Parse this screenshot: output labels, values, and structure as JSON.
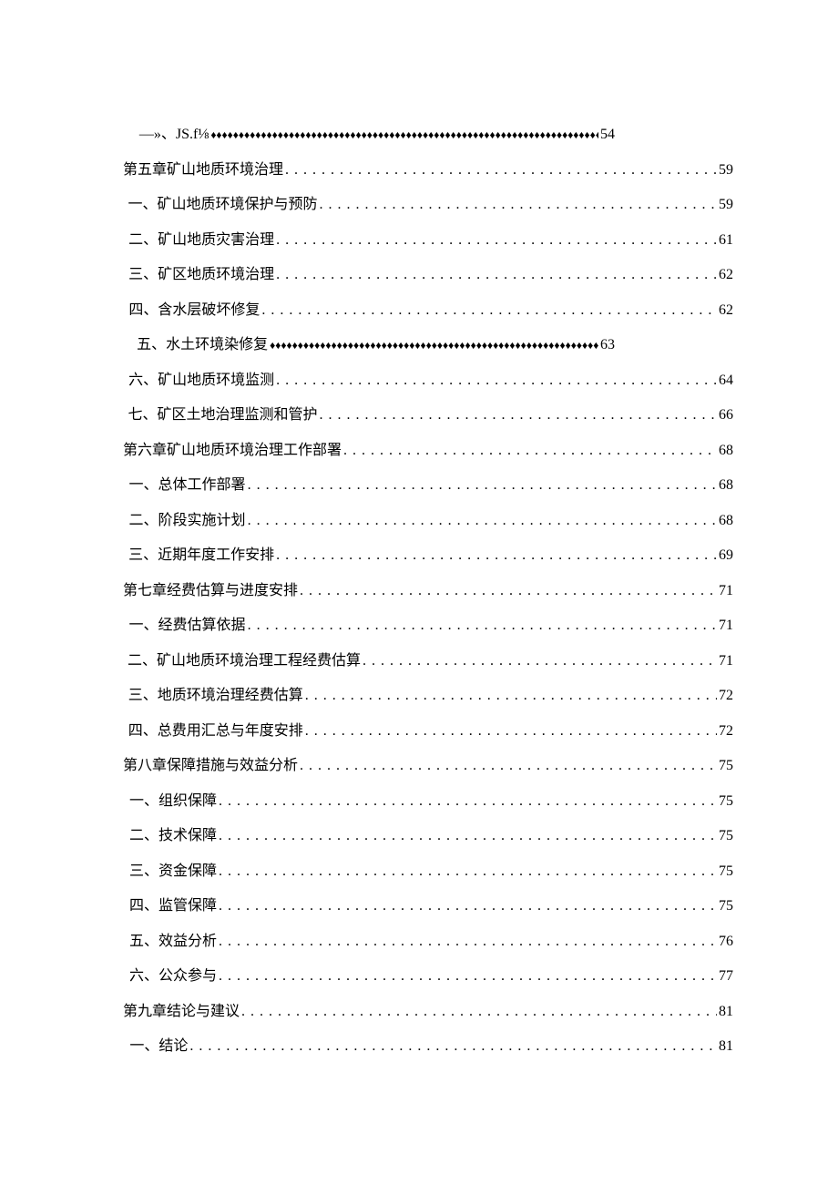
{
  "toc": [
    {
      "level": 2,
      "label": "—»、JS.f⅛",
      "page": "54",
      "leader": "diamonds",
      "short": true
    },
    {
      "level": 1,
      "label": "第五章矿山地质环境治理",
      "page": "59",
      "leader": "dots"
    },
    {
      "level": 2,
      "label": "一、矿山地质环境保护与预防",
      "page": "59",
      "leader": "dots"
    },
    {
      "level": 2,
      "label": "二、矿山地质灾害治理",
      "page": "61",
      "leader": "dots"
    },
    {
      "level": 2,
      "label": "三、矿区地质环境治理",
      "page": "62",
      "leader": "dots"
    },
    {
      "level": 2,
      "label": "四、含水层破坏修复",
      "page": "62",
      "leader": "dots"
    },
    {
      "level": 2,
      "label": "五、水土环境染修复",
      "page": "63",
      "leader": "diamonds",
      "short": true
    },
    {
      "level": 2,
      "label": "六、矿山地质环境监测",
      "page": "64",
      "leader": "dots"
    },
    {
      "level": 2,
      "label": "七、矿区土地治理监测和管护",
      "page": "66",
      "leader": "dots"
    },
    {
      "level": 1,
      "label": "第六章矿山地质环境治理工作部署",
      "page": "68",
      "leader": "dots"
    },
    {
      "level": 2,
      "label": "一、总体工作部署",
      "page": "68",
      "leader": "dots"
    },
    {
      "level": 2,
      "label": "二、阶段实施计划",
      "page": "68",
      "leader": "dots"
    },
    {
      "level": 2,
      "label": "三、近期年度工作安排",
      "page": "69",
      "leader": "dots"
    },
    {
      "level": 1,
      "label": "第七章经费估算与进度安排",
      "page": "71",
      "leader": "dots"
    },
    {
      "level": 2,
      "label": "一、经费估算依据",
      "page": "71",
      "leader": "dots"
    },
    {
      "level": 2,
      "label": "二、矿山地质环境治理工程经费估算",
      "page": "71",
      "leader": "dots"
    },
    {
      "level": 2,
      "label": "三、地质环境治理经费估算",
      "page": "72",
      "leader": "dots"
    },
    {
      "level": 2,
      "label": "四、总费用汇总与年度安排",
      "page": "72",
      "leader": "dots"
    },
    {
      "level": 1,
      "label": "第八章保障措施与效益分析",
      "page": "75",
      "leader": "dots"
    },
    {
      "level": 2,
      "label": "一、组织保障",
      "page": "75",
      "leader": "dots"
    },
    {
      "level": 2,
      "label": "二、技术保障",
      "page": "75",
      "leader": "dots"
    },
    {
      "level": 2,
      "label": "三、资金保障",
      "page": "75",
      "leader": "dots"
    },
    {
      "level": 2,
      "label": "四、监管保障",
      "page": "75",
      "leader": "dots"
    },
    {
      "level": 2,
      "label": "五、效益分析",
      "page": "76",
      "leader": "dots"
    },
    {
      "level": 2,
      "label": "六、公众参与",
      "page": "77",
      "leader": "dots"
    },
    {
      "level": 1,
      "label": "第九章结论与建议",
      "page": "81",
      "leader": "dots"
    },
    {
      "level": 2,
      "label": "一、结论",
      "page": "81",
      "leader": "dots"
    }
  ]
}
